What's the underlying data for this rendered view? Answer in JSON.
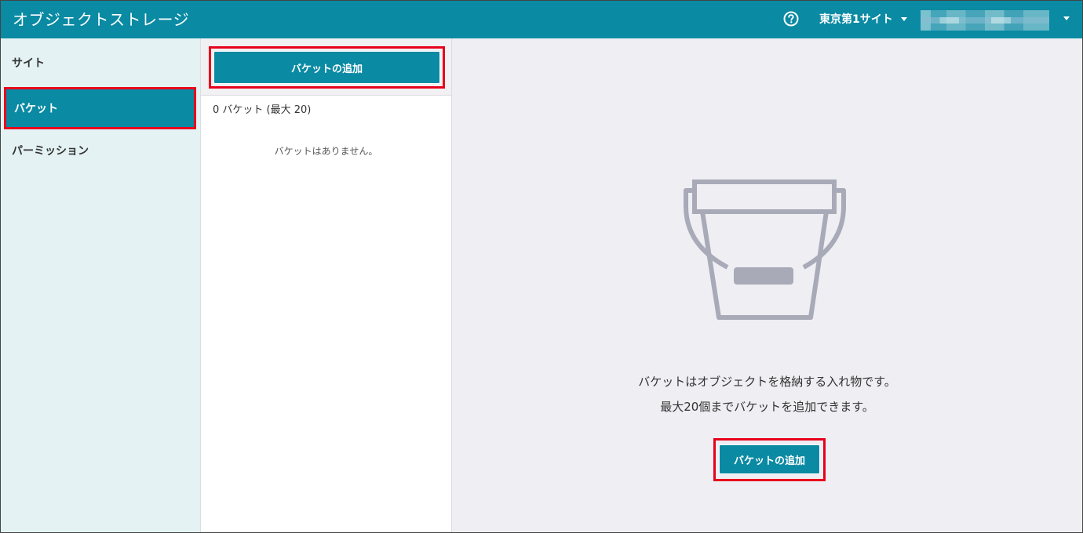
{
  "header": {
    "app_title": "オブジェクトストレージ",
    "site_selector_label": "東京第1サイト",
    "help_icon": "question-circle-icon",
    "user_menu_icon": "chevron-down-icon"
  },
  "sidebar": {
    "items": [
      {
        "label": "サイト",
        "active": false
      },
      {
        "label": "バケット",
        "active": true
      },
      {
        "label": "パーミッション",
        "active": false
      }
    ]
  },
  "list_panel": {
    "add_button_label": "バケットの追加",
    "count_text": "0 バケット (最大 20)",
    "empty_text": "バケットはありません。"
  },
  "main_panel": {
    "illustration_icon": "bucket-icon",
    "description_line1": "バケットはオブジェクトを格納する入れ物です。",
    "description_line2": "最大20個までバケットを追加できます。",
    "add_button_label": "バケットの追加"
  },
  "colors": {
    "header_bg": "#0a8aa3",
    "accent": "#0a8aa3",
    "highlight": "#e8001c",
    "sidebar_bg": "#e4f2f3",
    "main_bg": "#eeeef3",
    "illustration": "#a9aab8"
  }
}
